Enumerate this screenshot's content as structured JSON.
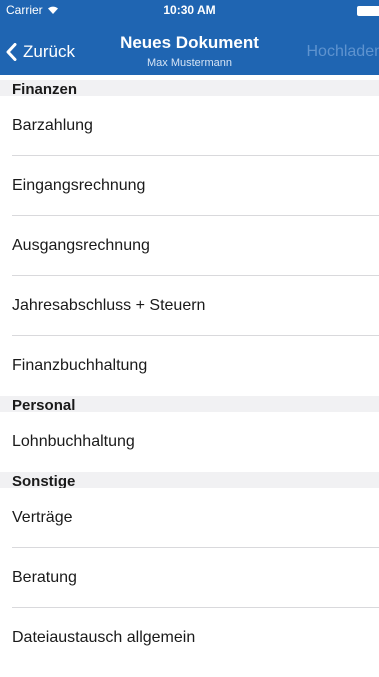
{
  "status_bar": {
    "carrier": "Carrier",
    "time": "10:30 AM"
  },
  "nav": {
    "back_label": "Zurück",
    "title": "Neues Dokument",
    "subtitle": "Max Mustermann",
    "upload_label": "Hochladen"
  },
  "sections": [
    {
      "header": "Finanzen",
      "items": [
        "Barzahlung",
        "Eingangsrechnung",
        "Ausgangsrechnung",
        "Jahresabschluss + Steuern",
        "Finanzbuchhaltung"
      ]
    },
    {
      "header": "Personal",
      "items": [
        "Lohnbuchhaltung"
      ]
    },
    {
      "header": "Sonstige",
      "items": [
        "Verträge",
        "Beratung",
        "Dateiaustausch allgemein"
      ]
    }
  ],
  "colors": {
    "nav_background": "#1f65b2",
    "section_background": "#f1f1f3",
    "upload_disabled": "#5e93cf"
  }
}
